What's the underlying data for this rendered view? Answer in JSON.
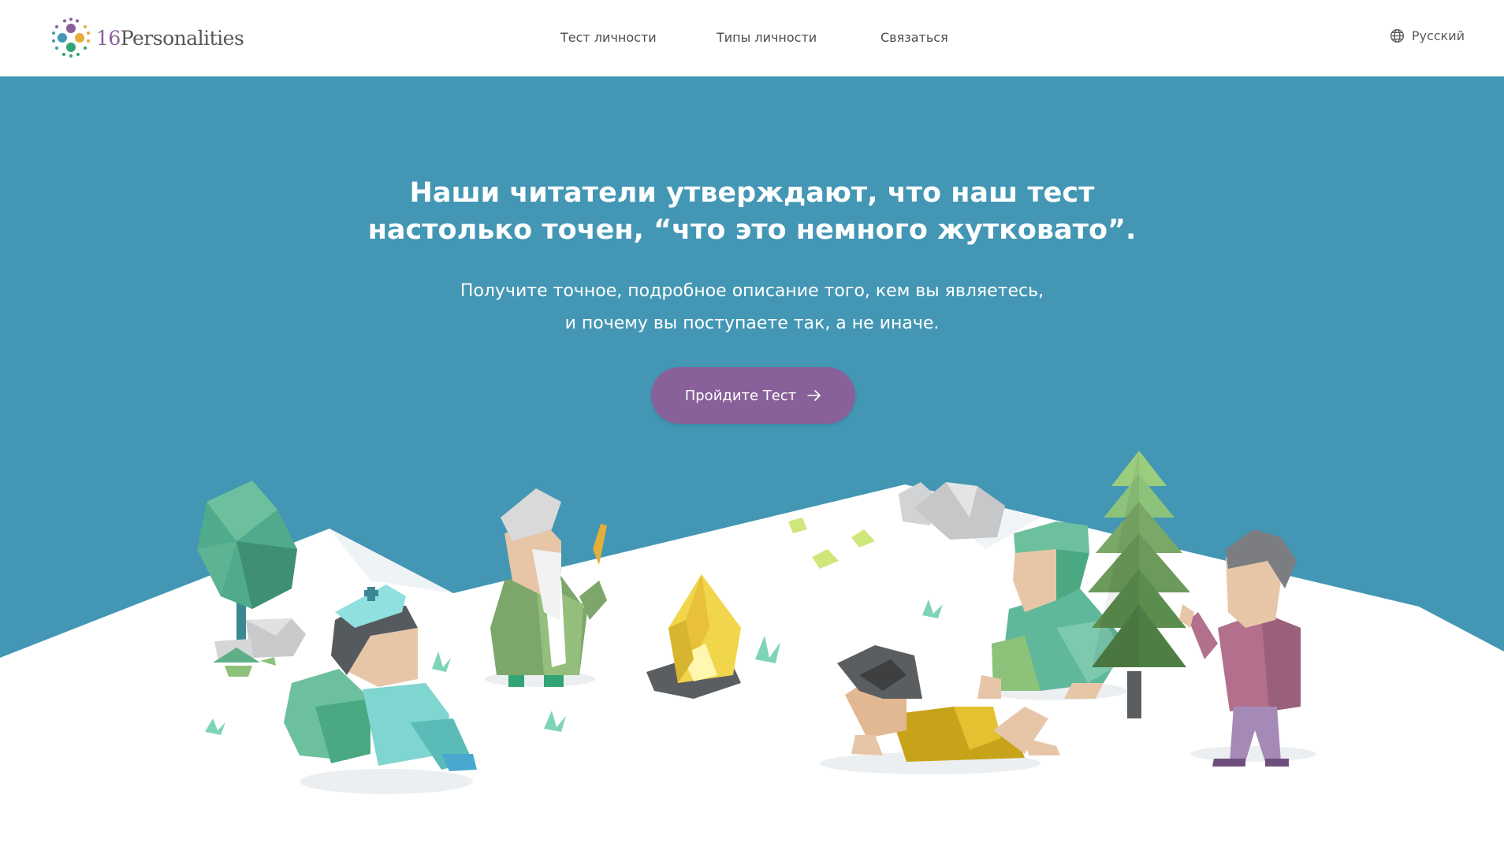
{
  "header": {
    "logo_number": "16",
    "logo_name": "Personalities",
    "nav": [
      {
        "label": "Тест личности"
      },
      {
        "label": "Типы личности"
      },
      {
        "label": "Связаться"
      }
    ],
    "language": "Русский"
  },
  "hero": {
    "headline_line1": "Наши читатели утверждают, что наш тест",
    "headline_line2": "настолько точен, “что это немного жутковато”.",
    "subline_line1": "Получите точное, подробное описание того, кем вы являетесь,",
    "subline_line2": "и почему вы поступаете так, а не иначе.",
    "cta_label": "Пройдите Тест"
  },
  "colors": {
    "sky": "#4397b5",
    "brand_purple": "#88619a",
    "snow": "#ffffff"
  },
  "icons": [
    "logo-mark-icon",
    "globe-icon",
    "arrow-right-icon"
  ]
}
